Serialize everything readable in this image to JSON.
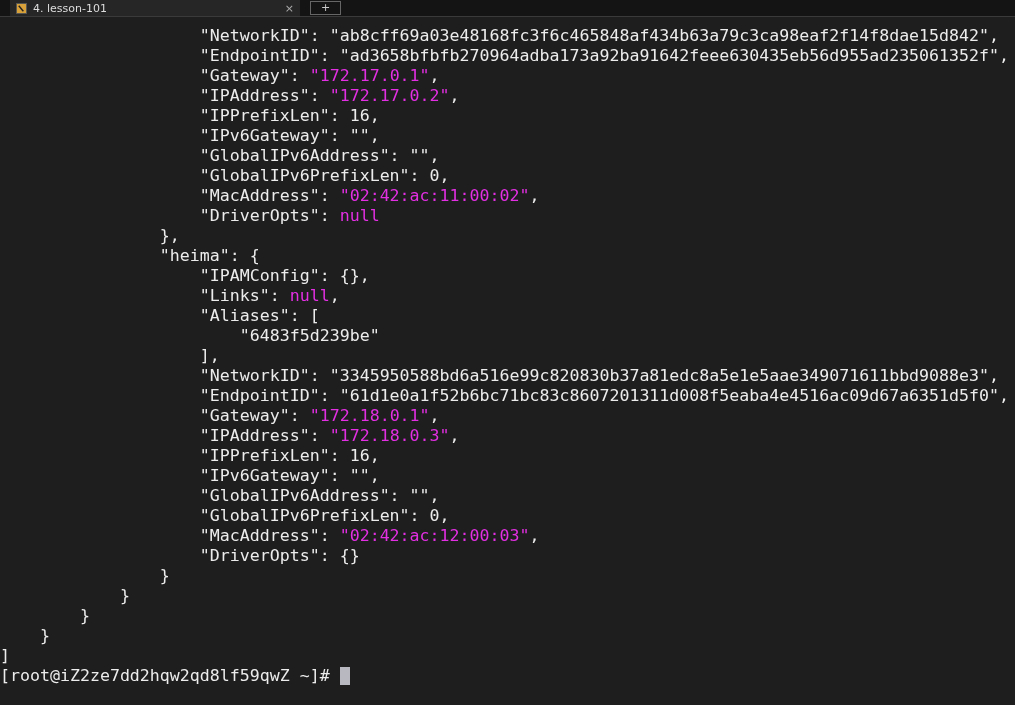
{
  "tab": {
    "title": "4. lesson-101",
    "close": "×",
    "new_tab": "+"
  },
  "lines": [
    {
      "segments": [
        {
          "kind": "plain",
          "text": "                    \"NetworkID\": \"ab8cff69a03e48168fc3f6c465848af434b63a79c3ca98eaf2f14f8dae15d842\","
        }
      ]
    },
    {
      "segments": [
        {
          "kind": "plain",
          "text": "                    \"EndpointID\": \"ad3658bfbfb270964adba173a92ba91642feee630435eb56d955ad235061352f\","
        }
      ]
    },
    {
      "segments": [
        {
          "kind": "plain",
          "text": "                    \"Gateway\": "
        },
        {
          "kind": "value",
          "text": "\"172.17.0.1\""
        },
        {
          "kind": "plain",
          "text": ","
        }
      ]
    },
    {
      "segments": [
        {
          "kind": "plain",
          "text": "                    \"IPAddress\": "
        },
        {
          "kind": "value",
          "text": "\"172.17.0.2\""
        },
        {
          "kind": "plain",
          "text": ","
        }
      ]
    },
    {
      "segments": [
        {
          "kind": "plain",
          "text": "                    \"IPPrefixLen\": 16,"
        }
      ]
    },
    {
      "segments": [
        {
          "kind": "plain",
          "text": "                    \"IPv6Gateway\": \"\","
        }
      ]
    },
    {
      "segments": [
        {
          "kind": "plain",
          "text": "                    \"GlobalIPv6Address\": \"\","
        }
      ]
    },
    {
      "segments": [
        {
          "kind": "plain",
          "text": "                    \"GlobalIPv6PrefixLen\": 0,"
        }
      ]
    },
    {
      "segments": [
        {
          "kind": "plain",
          "text": "                    \"MacAddress\": "
        },
        {
          "kind": "value",
          "text": "\"02:42:ac:11:00:02\""
        },
        {
          "kind": "plain",
          "text": ","
        }
      ]
    },
    {
      "segments": [
        {
          "kind": "plain",
          "text": "                    \"DriverOpts\": "
        },
        {
          "kind": "value",
          "text": "null"
        }
      ]
    },
    {
      "segments": [
        {
          "kind": "plain",
          "text": "                },"
        }
      ]
    },
    {
      "segments": [
        {
          "kind": "plain",
          "text": "                \"heima\": {"
        }
      ]
    },
    {
      "segments": [
        {
          "kind": "plain",
          "text": "                    \"IPAMConfig\": {},"
        }
      ]
    },
    {
      "segments": [
        {
          "kind": "plain",
          "text": "                    \"Links\": "
        },
        {
          "kind": "value",
          "text": "null"
        },
        {
          "kind": "plain",
          "text": ","
        }
      ]
    },
    {
      "segments": [
        {
          "kind": "plain",
          "text": "                    \"Aliases\": ["
        }
      ]
    },
    {
      "segments": [
        {
          "kind": "plain",
          "text": "                        \"6483f5d239be\""
        }
      ]
    },
    {
      "segments": [
        {
          "kind": "plain",
          "text": "                    ],"
        }
      ]
    },
    {
      "segments": [
        {
          "kind": "plain",
          "text": "                    \"NetworkID\": \"3345950588bd6a516e99c820830b37a81edc8a5e1e5aae349071611bbd9088e3\","
        }
      ]
    },
    {
      "segments": [
        {
          "kind": "plain",
          "text": "                    \"EndpointID\": \"61d1e0a1f52b6bc71bc83c8607201311d008f5eaba4e4516ac09d67a6351d5f0\","
        }
      ]
    },
    {
      "segments": [
        {
          "kind": "plain",
          "text": "                    \"Gateway\": "
        },
        {
          "kind": "value",
          "text": "\"172.18.0.1\""
        },
        {
          "kind": "plain",
          "text": ","
        }
      ]
    },
    {
      "segments": [
        {
          "kind": "plain",
          "text": "                    \"IPAddress\": "
        },
        {
          "kind": "value",
          "text": "\"172.18.0.3\""
        },
        {
          "kind": "plain",
          "text": ","
        }
      ]
    },
    {
      "segments": [
        {
          "kind": "plain",
          "text": "                    \"IPPrefixLen\": 16,"
        }
      ]
    },
    {
      "segments": [
        {
          "kind": "plain",
          "text": "                    \"IPv6Gateway\": \"\","
        }
      ]
    },
    {
      "segments": [
        {
          "kind": "plain",
          "text": "                    \"GlobalIPv6Address\": \"\","
        }
      ]
    },
    {
      "segments": [
        {
          "kind": "plain",
          "text": "                    \"GlobalIPv6PrefixLen\": 0,"
        }
      ]
    },
    {
      "segments": [
        {
          "kind": "plain",
          "text": "                    \"MacAddress\": "
        },
        {
          "kind": "value",
          "text": "\"02:42:ac:12:00:03\""
        },
        {
          "kind": "plain",
          "text": ","
        }
      ]
    },
    {
      "segments": [
        {
          "kind": "plain",
          "text": "                    \"DriverOpts\": {}"
        }
      ]
    },
    {
      "segments": [
        {
          "kind": "plain",
          "text": "                }"
        }
      ]
    },
    {
      "segments": [
        {
          "kind": "plain",
          "text": "            }"
        }
      ]
    },
    {
      "segments": [
        {
          "kind": "plain",
          "text": "        }"
        }
      ]
    },
    {
      "segments": [
        {
          "kind": "plain",
          "text": "    }"
        }
      ]
    },
    {
      "segments": [
        {
          "kind": "plain",
          "text": "]"
        }
      ]
    }
  ],
  "prompt": "[root@iZ2ze7dd2hqw2qd8lf59qwZ ~]#"
}
